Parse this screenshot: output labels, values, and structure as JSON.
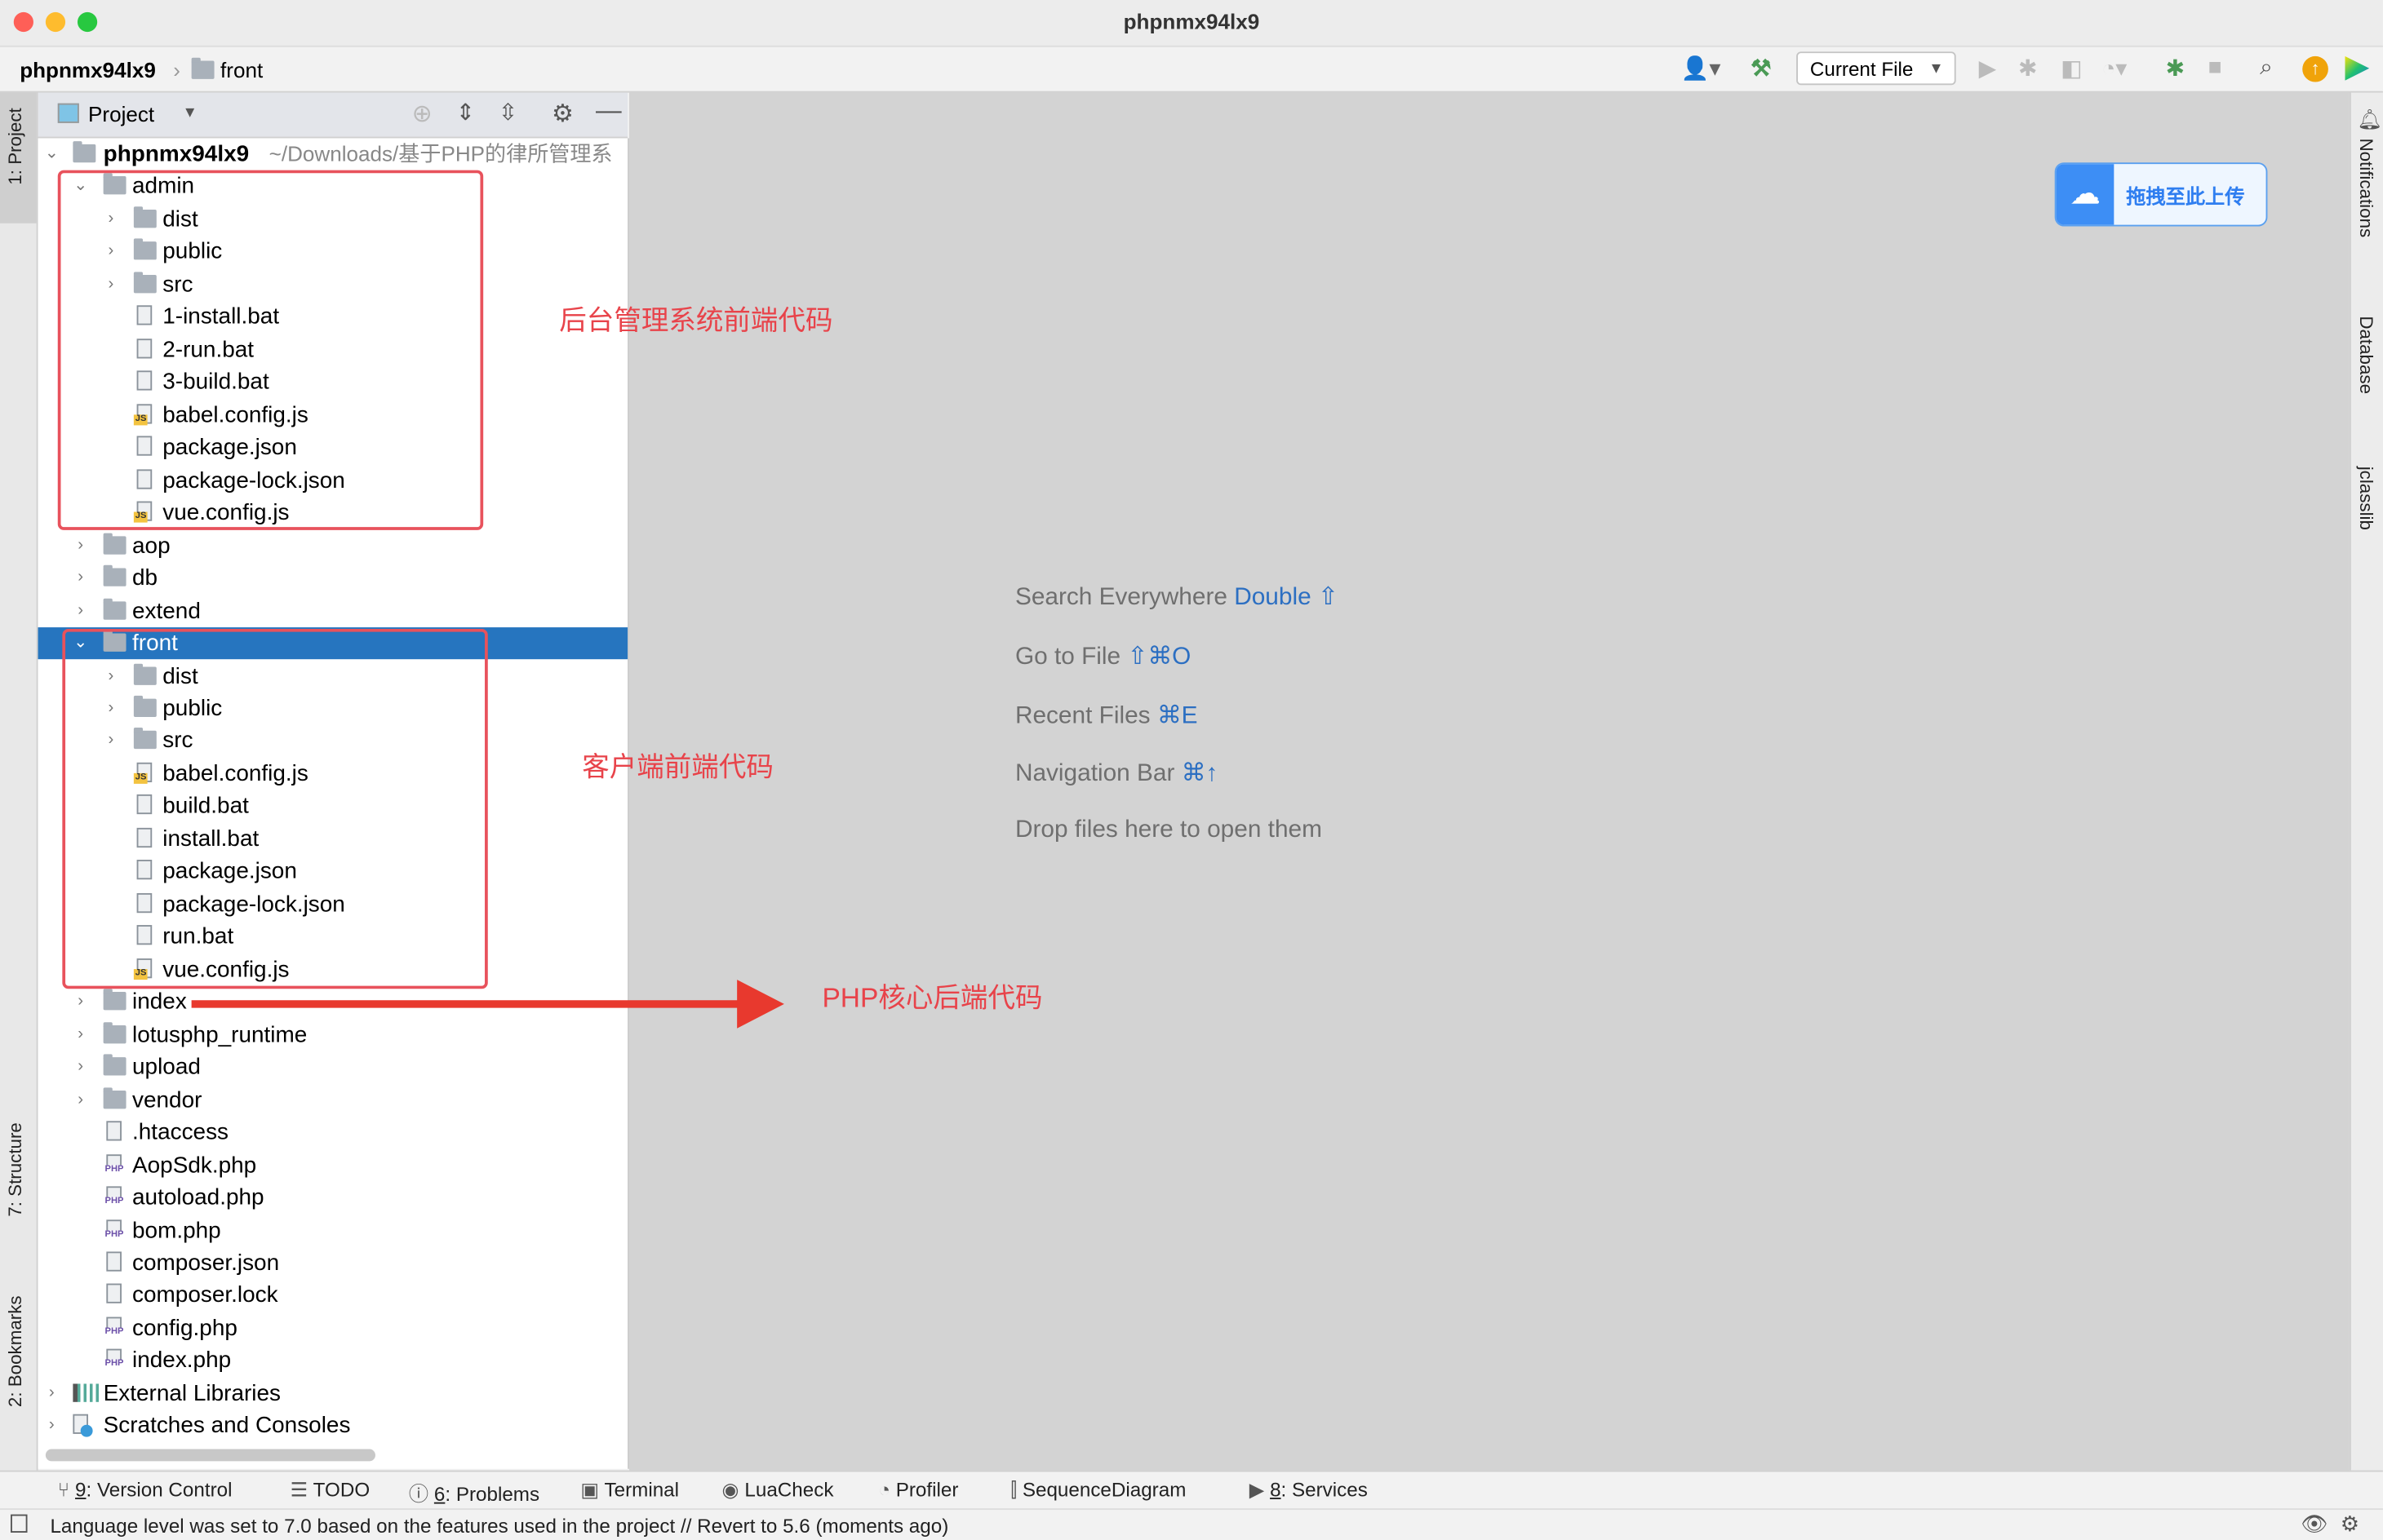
{
  "window": {
    "title": "phpnmx94lx9"
  },
  "breadcrumb": {
    "project": "phpnmx94lx9",
    "folder": "front"
  },
  "toolbar": {
    "run_config": "Current File"
  },
  "project_panel": {
    "title": "Project",
    "root_name": "phpnmx94lx9",
    "root_path": "~/Downloads/基于PHP的律所管理系"
  },
  "tree": [
    {
      "depth": 1,
      "type": "folder",
      "expanded": true,
      "name": "admin"
    },
    {
      "depth": 2,
      "type": "folder",
      "expanded": false,
      "name": "dist"
    },
    {
      "depth": 2,
      "type": "folder",
      "expanded": false,
      "name": "public"
    },
    {
      "depth": 2,
      "type": "folder",
      "expanded": false,
      "name": "src"
    },
    {
      "depth": 2,
      "type": "file",
      "name": "1-install.bat"
    },
    {
      "depth": 2,
      "type": "file",
      "name": "2-run.bat"
    },
    {
      "depth": 2,
      "type": "file",
      "name": "3-build.bat"
    },
    {
      "depth": 2,
      "type": "js",
      "name": "babel.config.js"
    },
    {
      "depth": 2,
      "type": "file",
      "name": "package.json"
    },
    {
      "depth": 2,
      "type": "file",
      "name": "package-lock.json"
    },
    {
      "depth": 2,
      "type": "js",
      "name": "vue.config.js"
    },
    {
      "depth": 1,
      "type": "folder",
      "expanded": false,
      "name": "aop"
    },
    {
      "depth": 1,
      "type": "folder",
      "expanded": false,
      "name": "db"
    },
    {
      "depth": 1,
      "type": "folder",
      "expanded": false,
      "name": "extend"
    },
    {
      "depth": 1,
      "type": "folder",
      "expanded": true,
      "name": "front",
      "selected": true
    },
    {
      "depth": 2,
      "type": "folder",
      "expanded": false,
      "name": "dist"
    },
    {
      "depth": 2,
      "type": "folder",
      "expanded": false,
      "name": "public"
    },
    {
      "depth": 2,
      "type": "folder",
      "expanded": false,
      "name": "src"
    },
    {
      "depth": 2,
      "type": "js",
      "name": "babel.config.js"
    },
    {
      "depth": 2,
      "type": "file",
      "name": "build.bat"
    },
    {
      "depth": 2,
      "type": "file",
      "name": "install.bat"
    },
    {
      "depth": 2,
      "type": "file",
      "name": "package.json"
    },
    {
      "depth": 2,
      "type": "file",
      "name": "package-lock.json"
    },
    {
      "depth": 2,
      "type": "file",
      "name": "run.bat"
    },
    {
      "depth": 2,
      "type": "js",
      "name": "vue.config.js"
    },
    {
      "depth": 1,
      "type": "folder",
      "expanded": false,
      "name": "index"
    },
    {
      "depth": 1,
      "type": "folder",
      "expanded": false,
      "name": "lotusphp_runtime"
    },
    {
      "depth": 1,
      "type": "folder",
      "expanded": false,
      "name": "upload"
    },
    {
      "depth": 1,
      "type": "folder",
      "expanded": false,
      "name": "vendor"
    },
    {
      "depth": 1,
      "type": "file",
      "name": ".htaccess"
    },
    {
      "depth": 1,
      "type": "php",
      "name": "AopSdk.php"
    },
    {
      "depth": 1,
      "type": "php",
      "name": "autoload.php"
    },
    {
      "depth": 1,
      "type": "php",
      "name": "bom.php"
    },
    {
      "depth": 1,
      "type": "file",
      "name": "composer.json"
    },
    {
      "depth": 1,
      "type": "file",
      "name": "composer.lock"
    },
    {
      "depth": 1,
      "type": "php",
      "name": "config.php"
    },
    {
      "depth": 1,
      "type": "php",
      "name": "index.php"
    },
    {
      "depth": 0,
      "type": "libs",
      "expanded": false,
      "name": "External Libraries"
    },
    {
      "depth": 0,
      "type": "scratch",
      "expanded": false,
      "name": "Scratches and Consoles"
    }
  ],
  "annotations": {
    "admin": "后台管理系统前端代码",
    "front": "客户端前端代码",
    "php": "PHP核心后端代码",
    "color": "#e8434a"
  },
  "editor": {
    "hints": [
      {
        "text": "Search Everywhere ",
        "key": "Double ⇧"
      },
      {
        "text": "Go to File ",
        "key": "⇧⌘O"
      },
      {
        "text": "Recent Files ",
        "key": "⌘E"
      },
      {
        "text": "Navigation Bar ",
        "key": "⌘↑"
      },
      {
        "text": "Drop files here to open them",
        "key": ""
      }
    ],
    "upload_button": "拖拽至此上传"
  },
  "left_stripe": {
    "project": "1: Project",
    "structure": "7: Structure",
    "bookmarks": "2: Bookmarks"
  },
  "right_stripe": {
    "notifications": "Notifications",
    "database": "Database",
    "jclasslib": "jclasslib"
  },
  "bottom_tools": [
    {
      "num": "9",
      "label": ": Version Control"
    },
    {
      "num": "",
      "label": "TODO"
    },
    {
      "num": "6",
      "label": ": Problems"
    },
    {
      "num": "",
      "label": "Terminal"
    },
    {
      "num": "",
      "label": "LuaCheck"
    },
    {
      "num": "",
      "label": "Profiler"
    },
    {
      "num": "",
      "label": "SequenceDiagram"
    },
    {
      "num": "8",
      "label": ": Services"
    }
  ],
  "status": {
    "message": "Language level was set to 7.0 based on the features used in the project // Revert to 5.6 (moments ago)"
  },
  "colors": {
    "selection": "#2675bf",
    "accent": "#2c6fc2"
  }
}
